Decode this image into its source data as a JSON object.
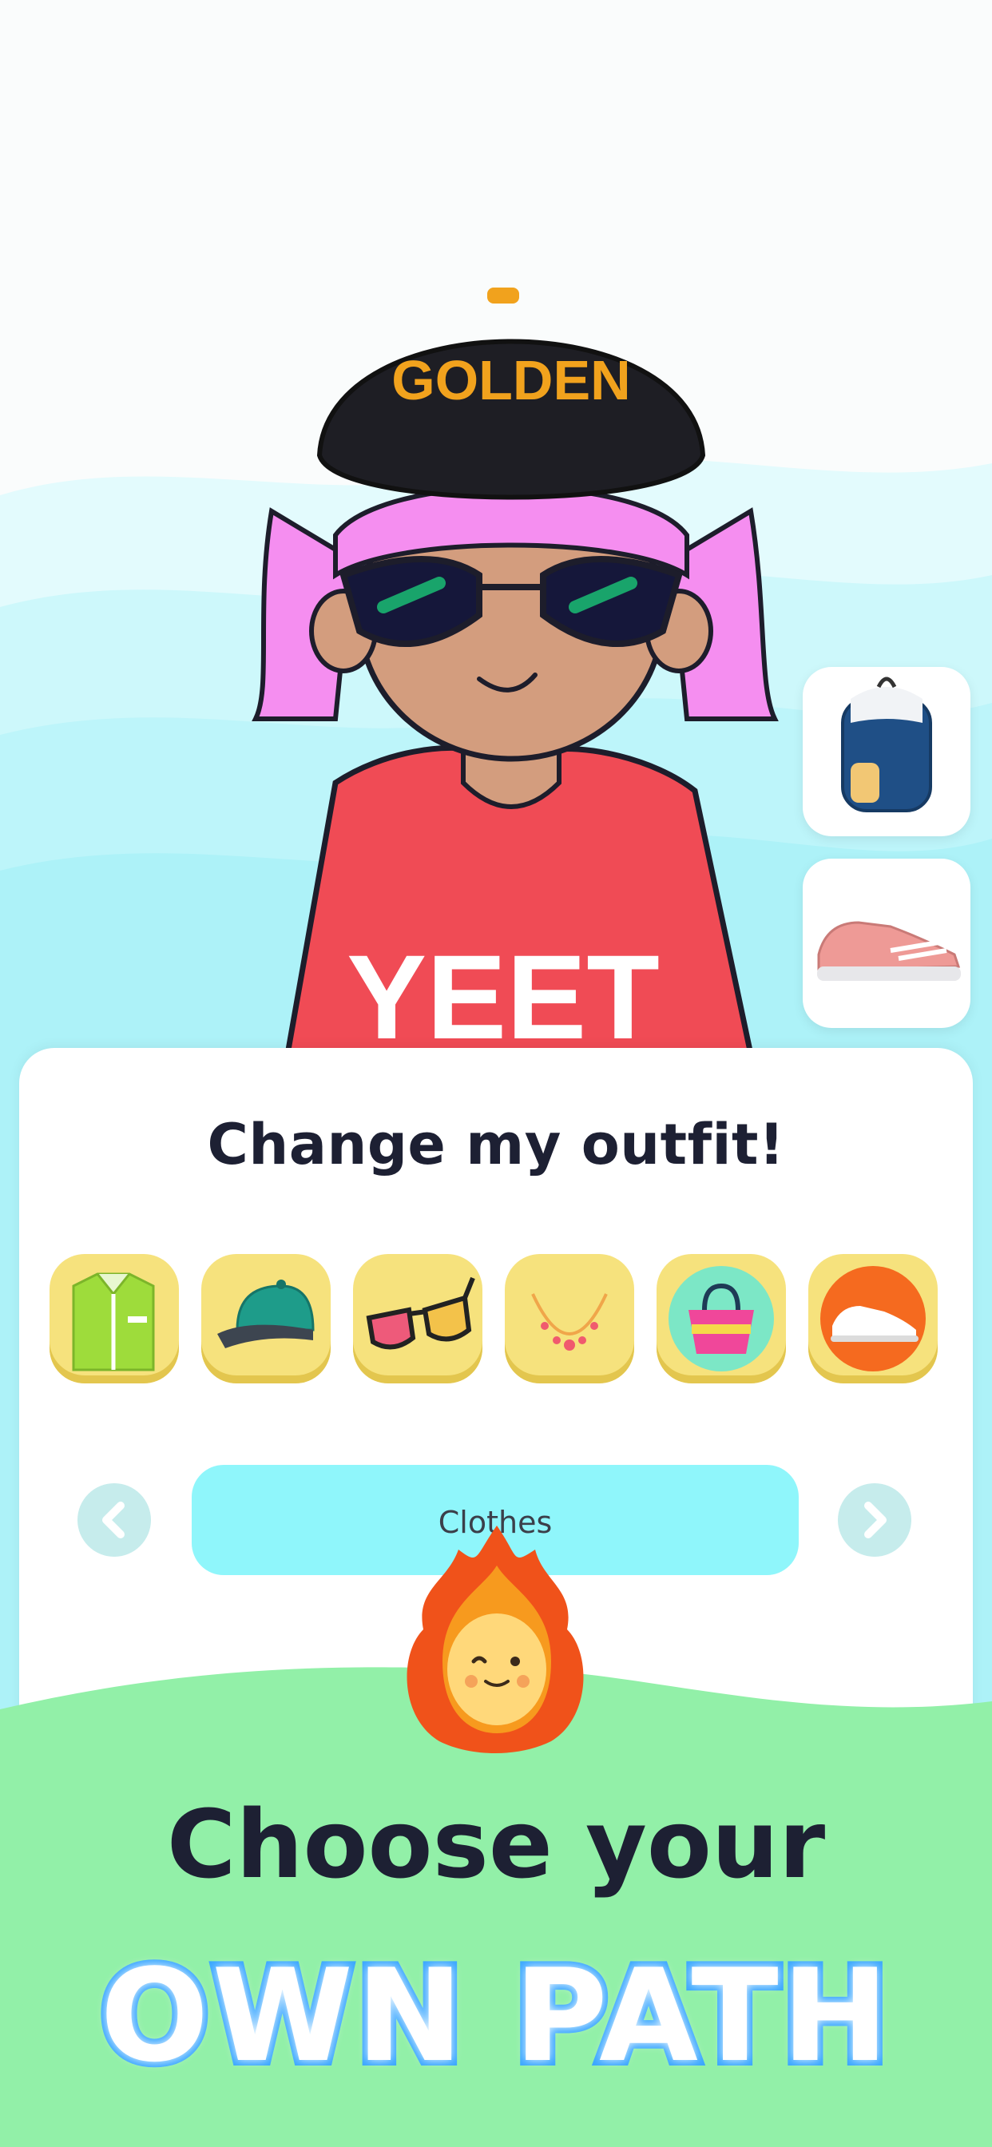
{
  "avatar": {
    "cap_text": "GOLDEN",
    "hoodie_text": "YEET"
  },
  "side_items": [
    {
      "icon": "backpack-icon"
    },
    {
      "icon": "sneaker-icon"
    }
  ],
  "outfit_panel": {
    "title": "Change my outfit!",
    "categories": [
      {
        "icon": "shirt-icon"
      },
      {
        "icon": "cap-icon"
      },
      {
        "icon": "sunglasses-icon"
      },
      {
        "icon": "necklace-icon"
      },
      {
        "icon": "bag-icon"
      },
      {
        "icon": "shoe-icon"
      }
    ],
    "selected_category": "Clothes"
  },
  "headline": {
    "line1": "Choose your",
    "line2": "OWN PATH"
  },
  "colors": {
    "accent_blue": "#3aa7ff",
    "panel_label_bg": "#8ff6fb",
    "hill_green": "#92f0a8",
    "wave_cyan": "#b5f4f9",
    "text_dark": "#1d2033"
  }
}
